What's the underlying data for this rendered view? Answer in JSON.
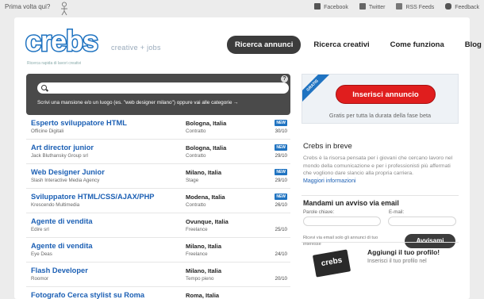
{
  "topbar": {
    "first_time": "Prima volta qui?",
    "links": [
      {
        "label": "Facebook",
        "icon": "facebook-icon",
        "color": "#555555"
      },
      {
        "label": "Twitter",
        "icon": "twitter-icon",
        "color": "#555555"
      },
      {
        "label": "RSS Feeds",
        "icon": "rss-icon",
        "color": "#555555"
      },
      {
        "label": "Feedback",
        "icon": "feedback-icon",
        "color": "#555555"
      }
    ]
  },
  "logo": {
    "word": "crebs",
    "tagline": "creative + jobs",
    "subtitle": "Ricerca rapida di lavori creativi",
    "color": "#1f73c1"
  },
  "nav": {
    "items": [
      "Ricerca annunci",
      "Ricerca creativi",
      "Come funziona",
      "Blog"
    ],
    "active_index": 0
  },
  "search": {
    "placeholder": "",
    "hint": "Scrivi una mansione e/o un luogo (es. \"web designer milano\") oppure vai alle categorie →",
    "help": "?"
  },
  "jobs": [
    {
      "title": "Esperto sviluppatore HTML",
      "company": "Officine Digitali",
      "place": "Bologna, Italia",
      "type": "Contratto",
      "new": true,
      "date": "30/10"
    },
    {
      "title": "Art director junior",
      "company": "Jack Bluthansky Group srl",
      "place": "Bologna, Italia",
      "type": "Contratto",
      "new": true,
      "date": "29/10"
    },
    {
      "title": "Web Designer Junior",
      "company": "Slash Interactive Media Agency",
      "place": "Milano, Italia",
      "type": "Stage",
      "new": true,
      "date": "29/10"
    },
    {
      "title": "Sviluppatore HTML/CSS/AJAX/PHP",
      "company": "Krescendo Multimedia",
      "place": "Modena, Italia",
      "type": "Contratto",
      "new": true,
      "date": "26/10"
    },
    {
      "title": "Agente di vendita",
      "company": "Edire srl",
      "place": "Ovunque, Italia",
      "type": "Freelance",
      "new": false,
      "date": "25/10"
    },
    {
      "title": "Agente di vendita",
      "company": "Eye Deas",
      "place": "Milano, Italia",
      "type": "Freelance",
      "new": false,
      "date": "24/10"
    },
    {
      "title": "Flash Developer",
      "company": "Roomor",
      "place": "Milano, Italia",
      "type": "Tempo pieno",
      "new": false,
      "date": "20/10"
    },
    {
      "title": "Fotografo Cerca stylist su Roma",
      "company": "",
      "place": "Roma, Italia",
      "type": "",
      "new": false,
      "date": ""
    }
  ],
  "new_label": "NEW",
  "promo": {
    "ribbon": "GRATIS",
    "button": "Inserisci annuncio",
    "text": "Gratis per tutta la durata della fase beta",
    "button_color": "#e01e1e"
  },
  "about": {
    "title": "Crebs in breve",
    "text": "Crebs è la risorsa pensata per i giovani che cercano lavoro nel mondo della comunicazione e per i professionisti più affermati che vogliono dare slancio alla propria carriera.",
    "link": "Maggiori informazioni"
  },
  "alert": {
    "title": "Mandami un avviso via email",
    "keywords_label": "Parole chiave:",
    "email_label": "E-mail:",
    "note": "Ricevi via email solo gli annunci di tuo interesse",
    "button": "Avvisami"
  },
  "profile": {
    "badge": "crebs",
    "title": "Aggiungi il tuo profilo!",
    "text": "Inserisci il tuo profilo nel"
  }
}
